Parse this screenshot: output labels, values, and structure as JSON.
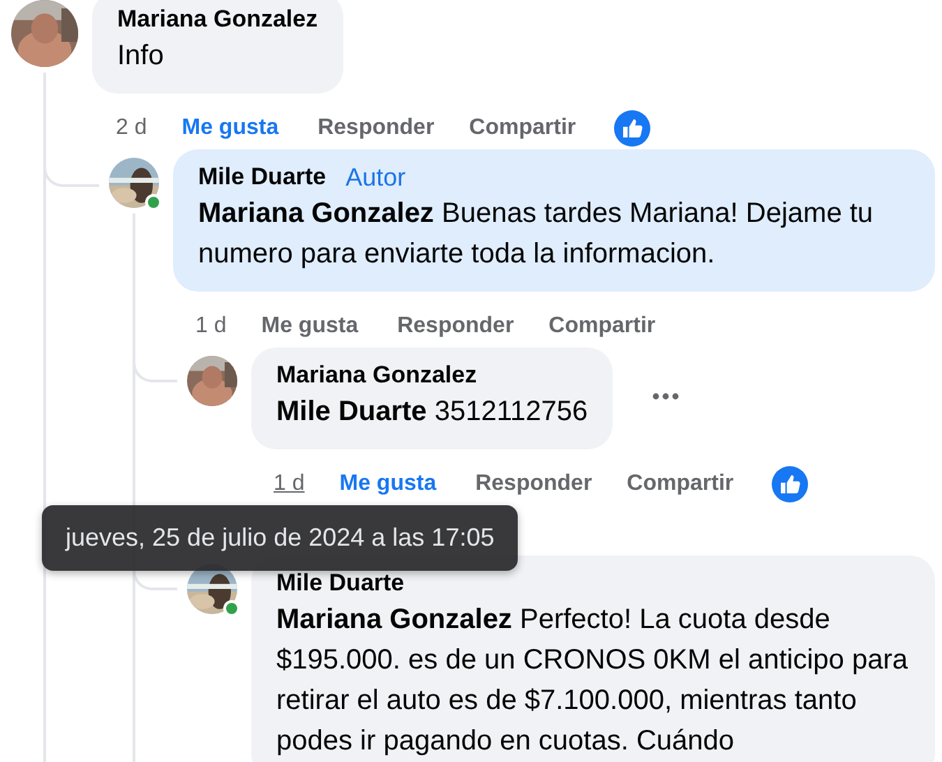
{
  "comments": [
    {
      "author": "Mariana Gonzalez",
      "text": "Info",
      "online": false,
      "highlighted": false,
      "liked": true,
      "reaction": {
        "kind": "like"
      },
      "more_button": false,
      "time": "2 d",
      "time_hovered": false,
      "actions": [
        {
          "label": "Me gusta",
          "kind": "like"
        },
        {
          "label": "Responder",
          "kind": "reply"
        },
        {
          "label": "Compartir",
          "kind": "share"
        }
      ],
      "replies": [
        {
          "author": "Mile Duarte",
          "badge": "Autor",
          "mention": "Mariana Gonzalez",
          "text": "Buenas tardes Mariana! Dejame tu numero para enviarte toda la informacion.",
          "online": true,
          "highlighted": true,
          "liked": false,
          "more_button": false,
          "time": "1 d",
          "time_hovered": false,
          "actions": [
            {
              "label": "Me gusta",
              "kind": "like"
            },
            {
              "label": "Responder",
              "kind": "reply"
            },
            {
              "label": "Compartir",
              "kind": "share"
            }
          ],
          "replies": [
            {
              "author": "Mariana Gonzalez",
              "mention": "Mile Duarte",
              "text": "3512112756",
              "online": false,
              "highlighted": false,
              "liked": true,
              "reaction": {
                "kind": "like"
              },
              "more_button": true,
              "time": "1 d",
              "time_hovered": true,
              "actions": [
                {
                  "label": "Me gusta",
                  "kind": "like"
                },
                {
                  "label": "Responder",
                  "kind": "reply"
                },
                {
                  "label": "Compartir",
                  "kind": "share"
                }
              ]
            },
            {
              "author": "Mile Duarte",
              "mention": "Mariana Gonzalez",
              "text": "Perfecto! La cuota desde $195.000. es de un CRONOS 0KM el anticipo para retirar el auto es de $7.100.000, mientras tanto podes ir pagando en cuotas. Cuándo",
              "online": true,
              "highlighted": false,
              "more_button": false
            }
          ]
        }
      ]
    }
  ],
  "tooltip": {
    "text": "jueves, 25 de julio de 2024 a las 17:05"
  }
}
